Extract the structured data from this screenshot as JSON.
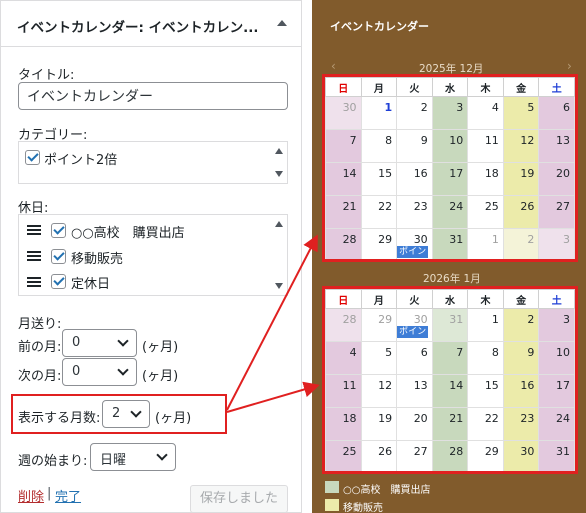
{
  "widget": {
    "header_title": "イベントカレンダー: イベントカレン...",
    "title_label": "タイトル:",
    "title_value": "イベントカレンダー",
    "category_label": "カテゴリー:",
    "categories": [
      {
        "label": "ポイント2倍",
        "checked": true
      }
    ],
    "holiday_label": "休日:",
    "holidays": [
      {
        "label": "○○高校　購買出店",
        "checked": true
      },
      {
        "label": "移動販売",
        "checked": true
      },
      {
        "label": "定休日",
        "checked": true
      }
    ],
    "month_nav_label": "月送り:",
    "prev_label": "前の月:",
    "prev_value": "0",
    "prev_unit": "(ヶ月)",
    "next_label": "次の月:",
    "next_value": "0",
    "next_unit": "(ヶ月)",
    "months_shown_label": "表示する月数:",
    "months_shown_value": "2",
    "months_shown_unit": "(ヶ月)",
    "week_start_label": "週の始まり:",
    "week_start_value": "日曜",
    "delete_link": "削除",
    "separator": "|",
    "done_link": "完了",
    "save_button": "保存しました"
  },
  "calendar": {
    "title": "イベントカレンダー",
    "prev_arrow": "‹",
    "next_arrow": "›",
    "weekdays": [
      "日",
      "月",
      "火",
      "水",
      "木",
      "金",
      "土"
    ],
    "months": [
      {
        "title": "2025年 12月",
        "weeks": [
          [
            {
              "d": "30",
              "c": "hol-c other"
            },
            {
              "d": "1",
              "c": "today"
            },
            {
              "d": "2",
              "c": ""
            },
            {
              "d": "3",
              "c": "hol-a"
            },
            {
              "d": "4",
              "c": ""
            },
            {
              "d": "5",
              "c": "hol-b"
            },
            {
              "d": "6",
              "c": "hol-c"
            }
          ],
          [
            {
              "d": "7",
              "c": "hol-c"
            },
            {
              "d": "8",
              "c": ""
            },
            {
              "d": "9",
              "c": ""
            },
            {
              "d": "10",
              "c": "hol-a"
            },
            {
              "d": "11",
              "c": ""
            },
            {
              "d": "12",
              "c": "hol-b"
            },
            {
              "d": "13",
              "c": "hol-c"
            }
          ],
          [
            {
              "d": "14",
              "c": "hol-c"
            },
            {
              "d": "15",
              "c": ""
            },
            {
              "d": "16",
              "c": ""
            },
            {
              "d": "17",
              "c": "hol-a"
            },
            {
              "d": "18",
              "c": ""
            },
            {
              "d": "19",
              "c": "hol-b"
            },
            {
              "d": "20",
              "c": "hol-c"
            }
          ],
          [
            {
              "d": "21",
              "c": "hol-c"
            },
            {
              "d": "22",
              "c": ""
            },
            {
              "d": "23",
              "c": ""
            },
            {
              "d": "24",
              "c": "hol-a"
            },
            {
              "d": "25",
              "c": ""
            },
            {
              "d": "26",
              "c": "hol-b"
            },
            {
              "d": "27",
              "c": "hol-c"
            }
          ],
          [
            {
              "d": "28",
              "c": "hol-c"
            },
            {
              "d": "29",
              "c": ""
            },
            {
              "d": "30",
              "c": "",
              "event": "ポイン"
            },
            {
              "d": "31",
              "c": "hol-a"
            },
            {
              "d": "1",
              "c": "other"
            },
            {
              "d": "2",
              "c": "hol-b other"
            },
            {
              "d": "3",
              "c": "hol-c other"
            }
          ]
        ]
      },
      {
        "title": "2026年 1月",
        "weeks": [
          [
            {
              "d": "28",
              "c": "hol-c other"
            },
            {
              "d": "29",
              "c": "other"
            },
            {
              "d": "30",
              "c": "other",
              "event": "ポイン"
            },
            {
              "d": "31",
              "c": "hol-a other"
            },
            {
              "d": "1",
              "c": ""
            },
            {
              "d": "2",
              "c": "hol-b"
            },
            {
              "d": "3",
              "c": "hol-c"
            }
          ],
          [
            {
              "d": "4",
              "c": "hol-c"
            },
            {
              "d": "5",
              "c": ""
            },
            {
              "d": "6",
              "c": ""
            },
            {
              "d": "7",
              "c": "hol-a"
            },
            {
              "d": "8",
              "c": ""
            },
            {
              "d": "9",
              "c": "hol-b"
            },
            {
              "d": "10",
              "c": "hol-c"
            }
          ],
          [
            {
              "d": "11",
              "c": "hol-c"
            },
            {
              "d": "12",
              "c": ""
            },
            {
              "d": "13",
              "c": ""
            },
            {
              "d": "14",
              "c": "hol-a"
            },
            {
              "d": "15",
              "c": ""
            },
            {
              "d": "16",
              "c": "hol-b"
            },
            {
              "d": "17",
              "c": "hol-c"
            }
          ],
          [
            {
              "d": "18",
              "c": "hol-c"
            },
            {
              "d": "19",
              "c": ""
            },
            {
              "d": "20",
              "c": ""
            },
            {
              "d": "21",
              "c": "hol-a"
            },
            {
              "d": "22",
              "c": ""
            },
            {
              "d": "23",
              "c": "hol-b"
            },
            {
              "d": "24",
              "c": "hol-c"
            }
          ],
          [
            {
              "d": "25",
              "c": "hol-c"
            },
            {
              "d": "26",
              "c": ""
            },
            {
              "d": "27",
              "c": ""
            },
            {
              "d": "28",
              "c": "hol-a"
            },
            {
              "d": "29",
              "c": ""
            },
            {
              "d": "30",
              "c": "hol-b"
            },
            {
              "d": "31",
              "c": "hol-c"
            }
          ]
        ]
      }
    ],
    "legend": [
      {
        "label": "○○高校　購買出店",
        "color": "#c8d9bd"
      },
      {
        "label": "移動販売",
        "color": "#ecebaa"
      }
    ]
  },
  "colors": {
    "panel_bg": "#815b2c",
    "annotation_red": "#e02020",
    "sunday": "#e00000",
    "saturday": "#1f3fd6"
  }
}
